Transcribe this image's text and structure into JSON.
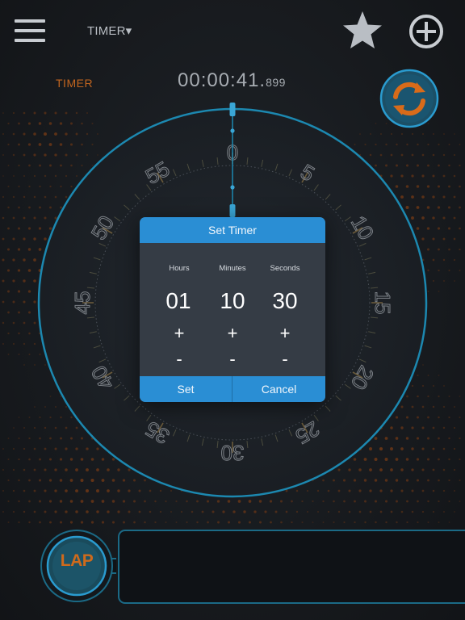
{
  "header": {
    "mode_selector": "TIMER▾",
    "icons": [
      "menu-icon",
      "star-icon",
      "add-circle-icon"
    ]
  },
  "status": {
    "mode_label": "TIMER",
    "clock_main": "00:00:41.",
    "clock_ms": "899"
  },
  "reset_icon": "refresh-icon",
  "dial": {
    "labels": [
      "0",
      "5",
      "10",
      "15",
      "20",
      "25",
      "30",
      "35",
      "40",
      "45",
      "50",
      "55"
    ]
  },
  "dialog": {
    "title": "Set Timer",
    "columns": [
      {
        "label": "Hours",
        "value": "01",
        "plus": "+",
        "minus": "-"
      },
      {
        "label": "Minutes",
        "value": "10",
        "plus": "+",
        "minus": "-"
      },
      {
        "label": "Seconds",
        "value": "30",
        "plus": "+",
        "minus": "-"
      }
    ],
    "set_label": "Set",
    "cancel_label": "Cancel"
  },
  "bottom": {
    "lap_label": "LAP"
  },
  "colors": {
    "accent_blue": "#2a8ed4",
    "ring_cyan": "#1c88b0",
    "orange": "#c2651f",
    "dialog_bg": "#353c45"
  }
}
